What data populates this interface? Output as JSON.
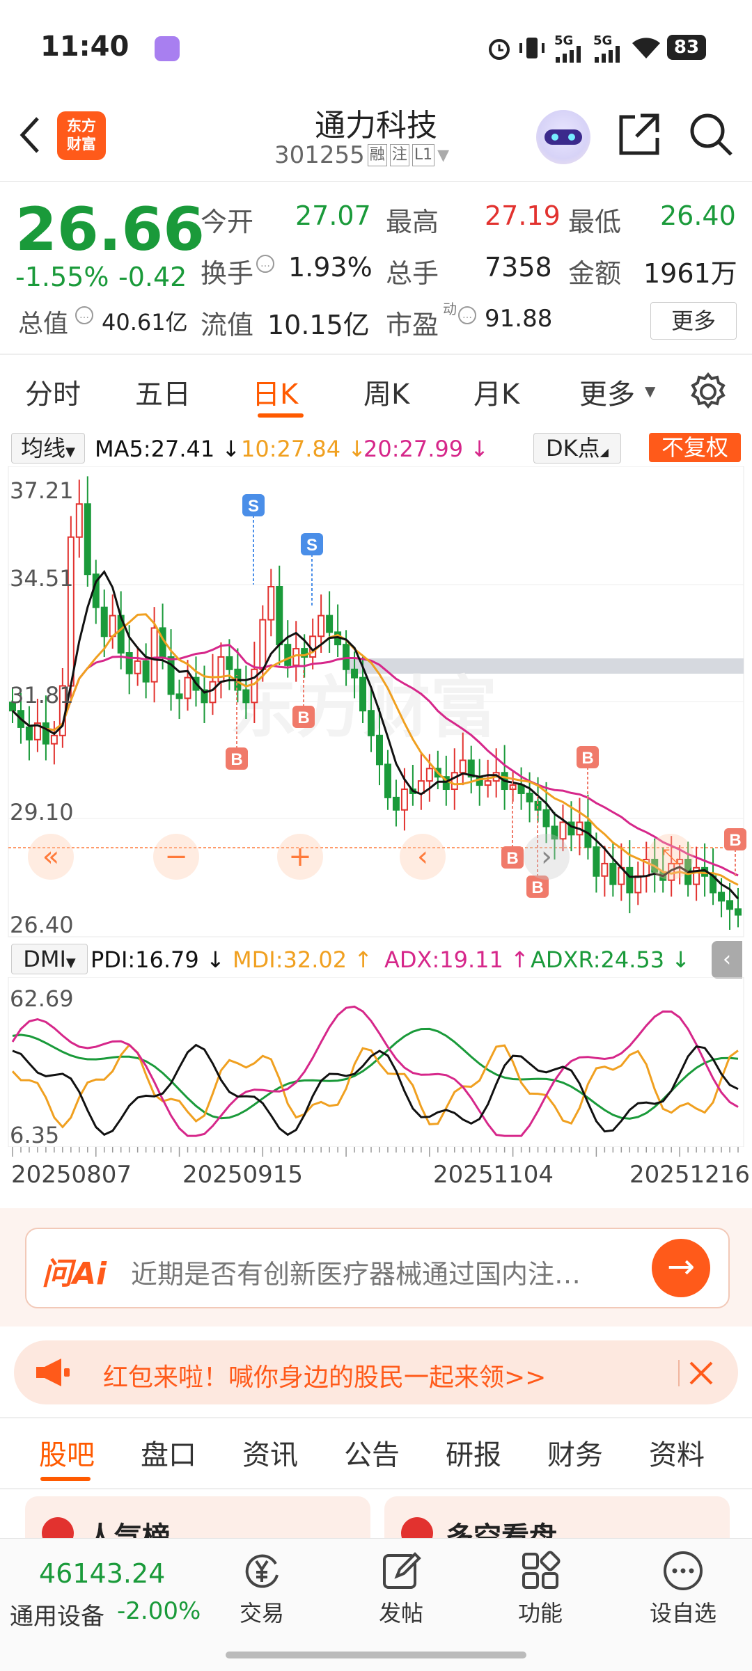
{
  "status": {
    "time": "11:40",
    "battery": "83",
    "signal1": "5G",
    "signal2": "5G"
  },
  "header": {
    "title": "通力科技",
    "code": "301255",
    "tags": [
      "融",
      "注",
      "L1"
    ],
    "logo_lines": [
      "东方",
      "财富"
    ]
  },
  "quote": {
    "price": "26.66",
    "change_pct": "-1.55%",
    "change": "-0.42",
    "stats": [
      {
        "label": "今开",
        "value": "27.07"
      },
      {
        "label": "最高",
        "value": "27.19"
      },
      {
        "label": "最低",
        "value": "26.40"
      },
      {
        "label": "换手",
        "value": "1.93%"
      },
      {
        "label": "总手",
        "value": "7358"
      },
      {
        "label": "金额",
        "value": "1961万"
      },
      {
        "label": "总值",
        "value": "40.61亿"
      },
      {
        "label": "流值",
        "value": "10.15亿"
      },
      {
        "label": "市盈",
        "value": "91.88",
        "sup": "动"
      }
    ],
    "more_label": "更多"
  },
  "period_tabs": [
    "分时",
    "五日",
    "日K",
    "周K",
    "月K",
    "更多"
  ],
  "active_tab": "日K",
  "ma_bar": {
    "selector": "均线",
    "ma5": "MA5:27.41",
    "ma10": "10:27.84",
    "ma20": "20:27.99",
    "dk": "DK点",
    "fq": "不复权",
    "arrow5": "↓",
    "arrow10": "↓",
    "arrow20": "↓"
  },
  "watermark": "东方财富",
  "kline": {
    "y_labels": [
      "37.21",
      "34.51",
      "31.81",
      "29.10",
      "26.40"
    ],
    "markers": {
      "S": "S",
      "B": "B"
    }
  },
  "dmi_bar": {
    "selector": "DMI",
    "pdi": "PDI:16.79",
    "mdi": "MDI:32.02",
    "adx": "ADX:19.11",
    "adxr": "ADXR:24.53",
    "arrow_pdi": "↓",
    "arrow_mdi": "↑",
    "arrow_adx": "↑",
    "arrow_adxr": "↓"
  },
  "dmi_axis": {
    "top": "62.69",
    "bottom": "6.35"
  },
  "date_axis": [
    "20250807",
    "20250915",
    "20251104",
    "20251216"
  ],
  "ai": {
    "label": "问Ai",
    "text": "近期是否有创新医疗器械通过国内注…"
  },
  "promo": {
    "text": "红包来啦！喊你身边的股民一起来领>>"
  },
  "bottom_tabs": [
    "股吧",
    "盘口",
    "资讯",
    "公告",
    "研报",
    "财务",
    "资料"
  ],
  "bottom_tab_active": "股吧",
  "cards": [
    "人气榜",
    "多空看盘"
  ],
  "footer": {
    "index_value": "46143.24",
    "index_name": "通用设备",
    "index_change": "-2.00%",
    "actions": [
      "交易",
      "发帖",
      "功能",
      "设自选"
    ]
  },
  "colors": {
    "accent": "#ff5a00",
    "up": "#e2322f",
    "down": "#1a9a3a",
    "ma5": "#111111",
    "ma10": "#f0a020",
    "ma20": "#d6278a"
  }
}
